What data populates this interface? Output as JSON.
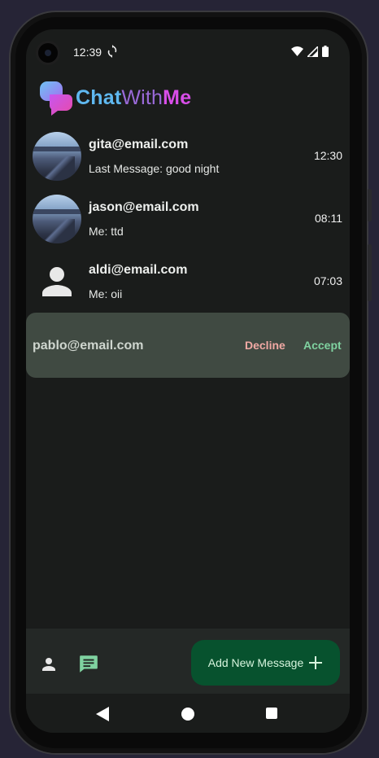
{
  "status_bar": {
    "time": "12:39",
    "icons": [
      "sync-icon",
      "wifi-icon",
      "signal-icon",
      "battery-icon"
    ]
  },
  "app": {
    "logo_part1": "Chat",
    "logo_part2": "With",
    "logo_part3": "Me",
    "colors": {
      "accent_blue": "#5fb8f0",
      "accent_purple": "#9a6ad8",
      "accent_pink": "#d84ee8"
    }
  },
  "chats": [
    {
      "email": "gita@email.com",
      "preview": "Last Message: good night",
      "time": "12:30",
      "avatar": "photo"
    },
    {
      "email": "jason@email.com",
      "preview": "Me: ttd",
      "time": "08:11",
      "avatar": "photo"
    },
    {
      "email": "aldi@email.com",
      "preview": "Me: oii",
      "time": "07:03",
      "avatar": "default-person-icon"
    }
  ],
  "request": {
    "email": "pablo@email.com",
    "decline_label": "Decline",
    "accept_label": "Accept",
    "colors": {
      "decline": "#f1a9a4",
      "accept": "#7fd2a0",
      "background": "#404a42"
    }
  },
  "bottom_bar": {
    "fab_label": "Add New Message",
    "nav_items": [
      "person-icon",
      "chat-icon"
    ],
    "active_item": "chat-icon",
    "colors": {
      "fab": "#07522e",
      "active": "#7fd2a0"
    }
  },
  "system_nav": {
    "buttons": [
      "back-icon",
      "home-icon",
      "recents-icon"
    ]
  }
}
